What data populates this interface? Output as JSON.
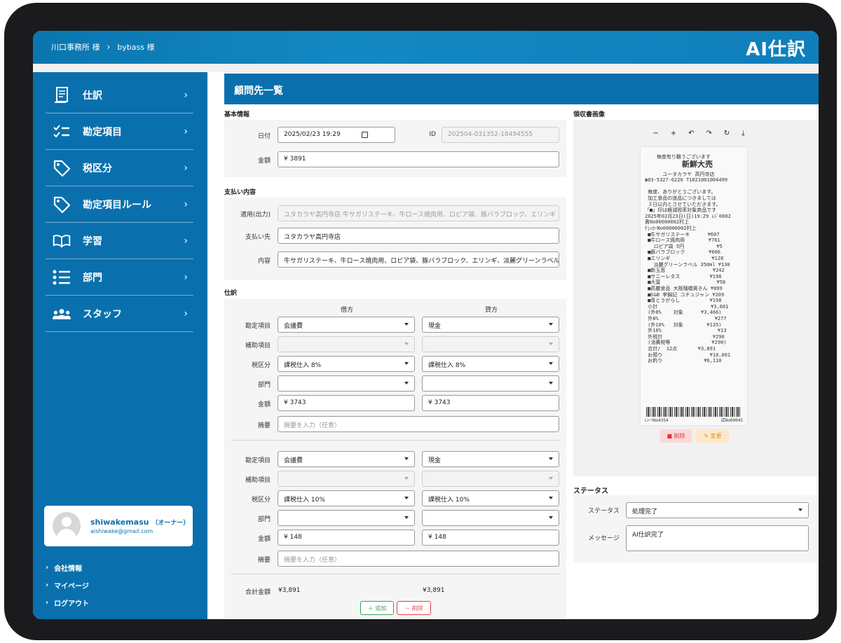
{
  "topbar": {
    "breadcrumb": [
      "川口事務所 様",
      "bybass 様"
    ],
    "logo": "AI仕訳"
  },
  "sidebar": {
    "items": [
      {
        "label": "仕訳",
        "icon": "journal-icon"
      },
      {
        "label": "勘定項目",
        "icon": "checklist-icon"
      },
      {
        "label": "税区分",
        "icon": "tag-icon"
      },
      {
        "label": "勘定項目ルール",
        "icon": "tag-icon"
      },
      {
        "label": "学習",
        "icon": "book-icon"
      },
      {
        "label": "部門",
        "icon": "list-icon"
      },
      {
        "label": "スタッフ",
        "icon": "users-icon"
      }
    ],
    "profile": {
      "name": "shiwakemasu",
      "role": "（オーナー）",
      "email": "aishiwake@gmail.com"
    },
    "links": [
      "会社情報",
      "マイページ",
      "ログアウト"
    ]
  },
  "main": {
    "title": "顧問先一覧",
    "basic": {
      "section": "基本情報",
      "date_label": "日付",
      "date_value": "2025/02/23 19:29",
      "id_label": "ID",
      "id_value": "202504-031352-18494555",
      "amount_label": "金額",
      "amount_value": "¥ 3891"
    },
    "payment": {
      "section": "支払い内容",
      "apply_label": "適用(出力)",
      "apply_value": "ユタカラヤ高円寺店 牛サガリステーキ、牛ロース焼肉用、ロピア袋、豚バラブロック、エリンギ",
      "payee_label": "支払い先",
      "payee_value": "ユタカラヤ高円寺店",
      "content_label": "内容",
      "content_value": "牛サガリステーキ、牛ロース焼肉用、ロピア袋、豚バラブロック、エリンギ、淡麗グリーンラベル"
    },
    "journal": {
      "section": "仕訳",
      "debit_head": "借方",
      "credit_head": "貸方",
      "row_labels": {
        "account": "勘定項目",
        "sub": "補助項目",
        "tax": "税区分",
        "dept": "部門",
        "amount": "金額",
        "memo": "摘要"
      },
      "memo_placeholder": "摘要を入力（任意）",
      "entries": [
        {
          "debit_account": "会議費",
          "credit_account": "現金",
          "debit_tax": "課税仕入 8%",
          "credit_tax": "課税仕入 8%",
          "debit_amount": "¥ 3743",
          "credit_amount": "¥ 3743"
        },
        {
          "debit_account": "会議費",
          "credit_account": "現金",
          "debit_tax": "課税仕入 10%",
          "credit_tax": "課税仕入 10%",
          "debit_amount": "¥ 148",
          "credit_amount": "¥ 148"
        }
      ],
      "total_label": "合計金額",
      "total_debit": "¥3,891",
      "total_credit": "¥3,891",
      "add_label": "＋ 追加",
      "delete_label": "－ 削除"
    },
    "receipt": {
      "section": "領収書画像",
      "tools": [
        "−",
        "+",
        "↶",
        "↷",
        "↻",
        "⤓"
      ],
      "delete_label": "削除",
      "edit_label": "変更",
      "lines": [
        "    毎度有り難うございます",
        "        新鮮大売",
        "      ユータカラヤ 高円寺店",
        "☎03-5327-6220 T1021001004499",
        "",
        " 毎度、ありがとうございます。",
        " 加工食品の道品につきましては",
        " ３日以内とさせていただきます。",
        "「■」印は軽減税率対象商品です",
        "2025年02月23日(日)19:29 ﾚｼﾞ0002",
        "責No00000002村上",
        "ﾁｪｯｶｰNo00000002村上",
        " ■牛サガリステーキ      ¥607",
        " ■牛ロース焼肉用        ¥761",
        "   ロピア袋 5円           ¥5",
        " ■豚バラブロック        ¥666",
        " ■エリンギ              ¥128",
        "   淡麗グリーンラベル 350ml ¥130",
        " ■新玉葱                ¥242",
        " ■サニーレタス          ¥198",
        " ■大葉                   ¥58",
        " ■高麗食品 大阪麺橋黄きん ¥899",
        " ■S&B 李錦記 コチュジャン ¥209",
        " ■青とうがらし          ¥198",
        " 小計                  ¥3,601",
        " (外8%    対象      ¥3,466)",
        " 外8%                   ¥277",
        " (外10%   対象        ¥135)",
        " 外10%                   ¥13",
        " 外税計                 ¥290",
        " (消費税等              ¥290)",
        " 合計/  12点       ¥3,891",
        " お預り                ¥10,001",
        " お釣り              ¥6,110"
      ],
      "footer_left": "ﾚｼｰﾄNo4354",
      "footer_right": "店No00045"
    },
    "status": {
      "section": "ステータス",
      "status_label": "ステータス",
      "status_value": "処理完了",
      "message_label": "メッセージ",
      "message_value": "AI仕訳完了"
    }
  }
}
